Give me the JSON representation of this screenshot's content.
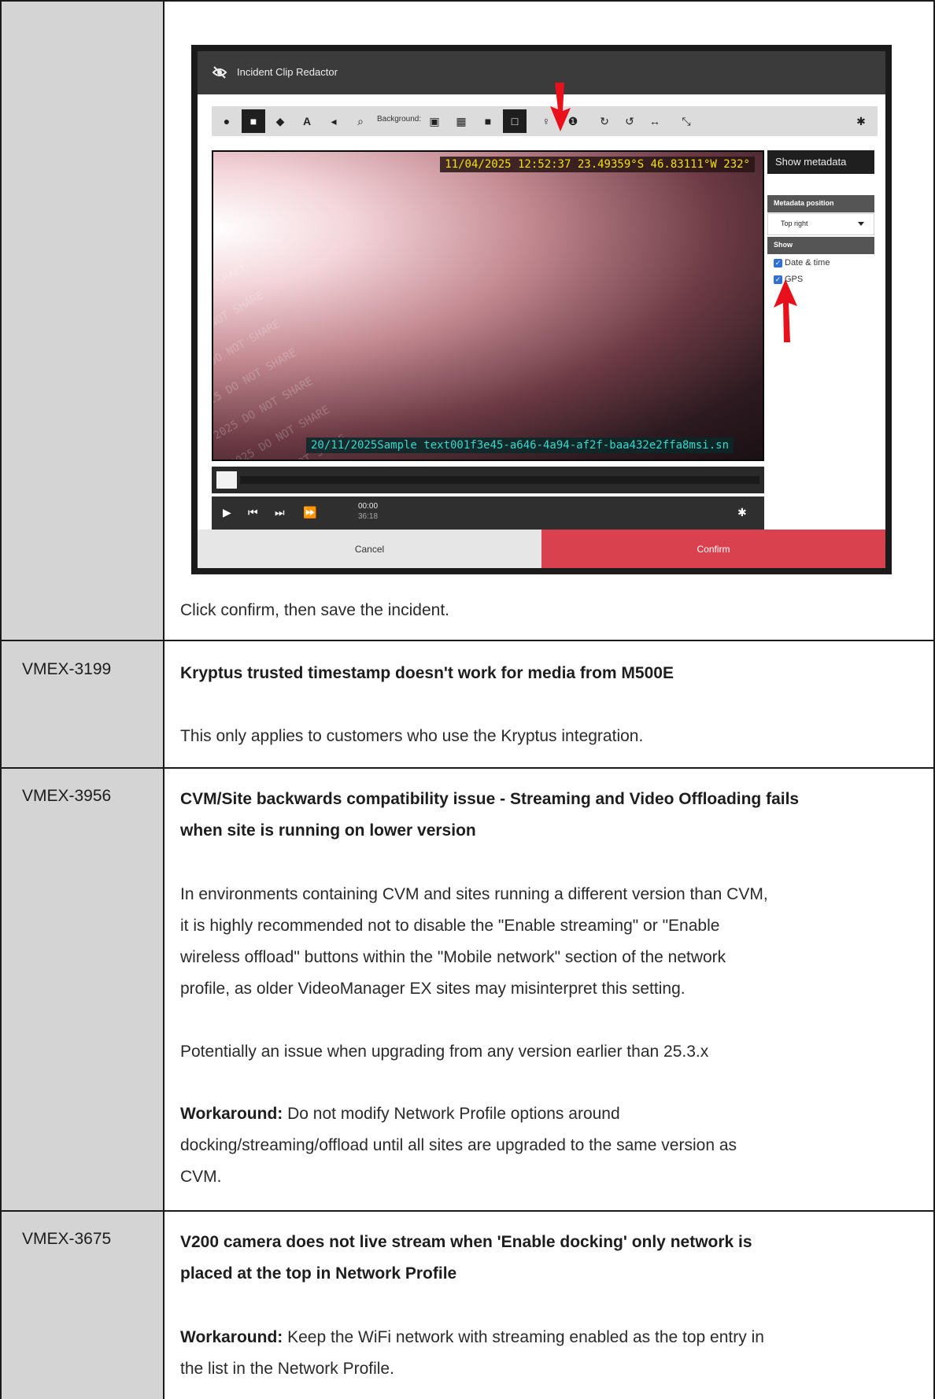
{
  "screenshot": {
    "window_title": "Incident Clip Redactor",
    "background_label": "Background:",
    "metadata_overlay": "11/04/2025 12:52:37 23.49359°S 46.83111°W 232°",
    "bottom_overlay": "20/11/2025Sample text001f3e45-a646-4a94-af2f-baa432e2ffa8msi.sn",
    "watermark_text": "Viewer msi.sn 20/11/2025 DO NOT SHARE",
    "side_panel": {
      "header": "Show metadata",
      "position_label": "Metadata position",
      "position_value": "Top right",
      "show_label": "Show",
      "date_time_label": "Date & time",
      "gps_label": "GPS"
    },
    "player": {
      "current_time": "00:00",
      "duration": "36:18"
    },
    "cancel_label": "Cancel",
    "confirm_label": "Confirm",
    "colors": {
      "confirm": "#d9414f",
      "arrow": "#e8101b",
      "overlay_yellow": "#f2e200",
      "overlay_cyan": "#33d9d0"
    }
  },
  "instruction": "Click confirm, then save the incident.",
  "issues": [
    {
      "id": "VMEX-3199",
      "title": "Kryptus trusted timestamp doesn't work for media from M500E",
      "body": "This only applies to customers who use the Kryptus integration."
    },
    {
      "id": "VMEX-3956",
      "title_line1": "CVM/Site backwards compatibility issue - Streaming and Video Offloading fails",
      "title_line2": "when site is running on lower version",
      "body_lines": [
        "In environments containing CVM and sites running a different version than CVM,",
        "it is highly recommended not to disable the \"Enable streaming\" or \"Enable",
        "wireless offload\" buttons within the \"Mobile network\" section of the network",
        "profile, as older VideoManager EX sites may misinterpret this setting."
      ],
      "note": "Potentially an issue when upgrading from any version earlier than 25.3.x",
      "workaround_label": "Workaround:",
      "workaround_lines": [
        " Do not modify Network Profile options around",
        "docking/streaming/offload until all sites are upgraded to the same version as",
        "CVM."
      ]
    },
    {
      "id": "VMEX-3675",
      "title_line1": "V200 camera does not live stream when 'Enable docking' only network is",
      "title_line2": "placed at the top in Network Profile",
      "workaround_label": "Workaround:",
      "workaround_lines": [
        " Keep the WiFi network with streaming enabled as the top entry in",
        "the list in the Network Profile."
      ]
    }
  ]
}
